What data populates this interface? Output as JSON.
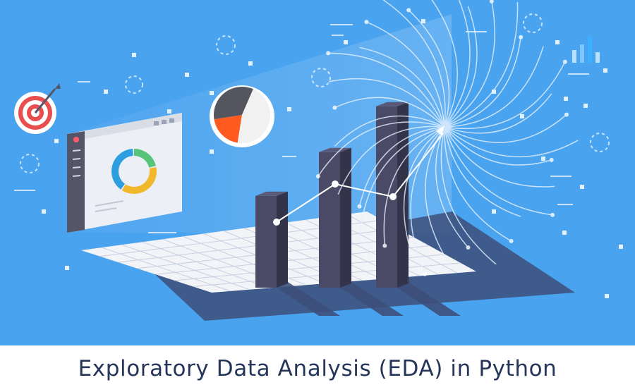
{
  "caption": "Exploratory Data Analysis (EDA) in Python",
  "colors": {
    "background": "#4aa3ef",
    "bar": "#4a4a66",
    "bar_side": "#333349",
    "floor_grid": "#f2f4f8",
    "platform_shadow": "#3f5078",
    "pie_orange": "#ff5a1f",
    "pie_dark": "#555560",
    "pie_light": "#f1f1f1",
    "donut_green": "#58c47a",
    "donut_yellow": "#f2b82c",
    "donut_blue": "#2d9ee0",
    "target_red": "#e84e4e",
    "caption_text": "#26365a"
  },
  "icons": {
    "target": "target-icon",
    "pie": "pie-chart-icon",
    "dashboard": "dashboard-window-icon",
    "donut": "donut-chart-icon",
    "mini_bars": "mini-bar-chart-icon",
    "trend_arrow": "trend-arrow-icon"
  },
  "pie_slices": [
    0.2,
    0.34,
    0.46
  ],
  "donut_segments": [
    0.22,
    0.38,
    0.4
  ],
  "bar_heights": [
    0.42,
    0.62,
    0.83
  ],
  "trend_points": [
    0.25,
    0.55,
    0.45,
    0.95
  ]
}
